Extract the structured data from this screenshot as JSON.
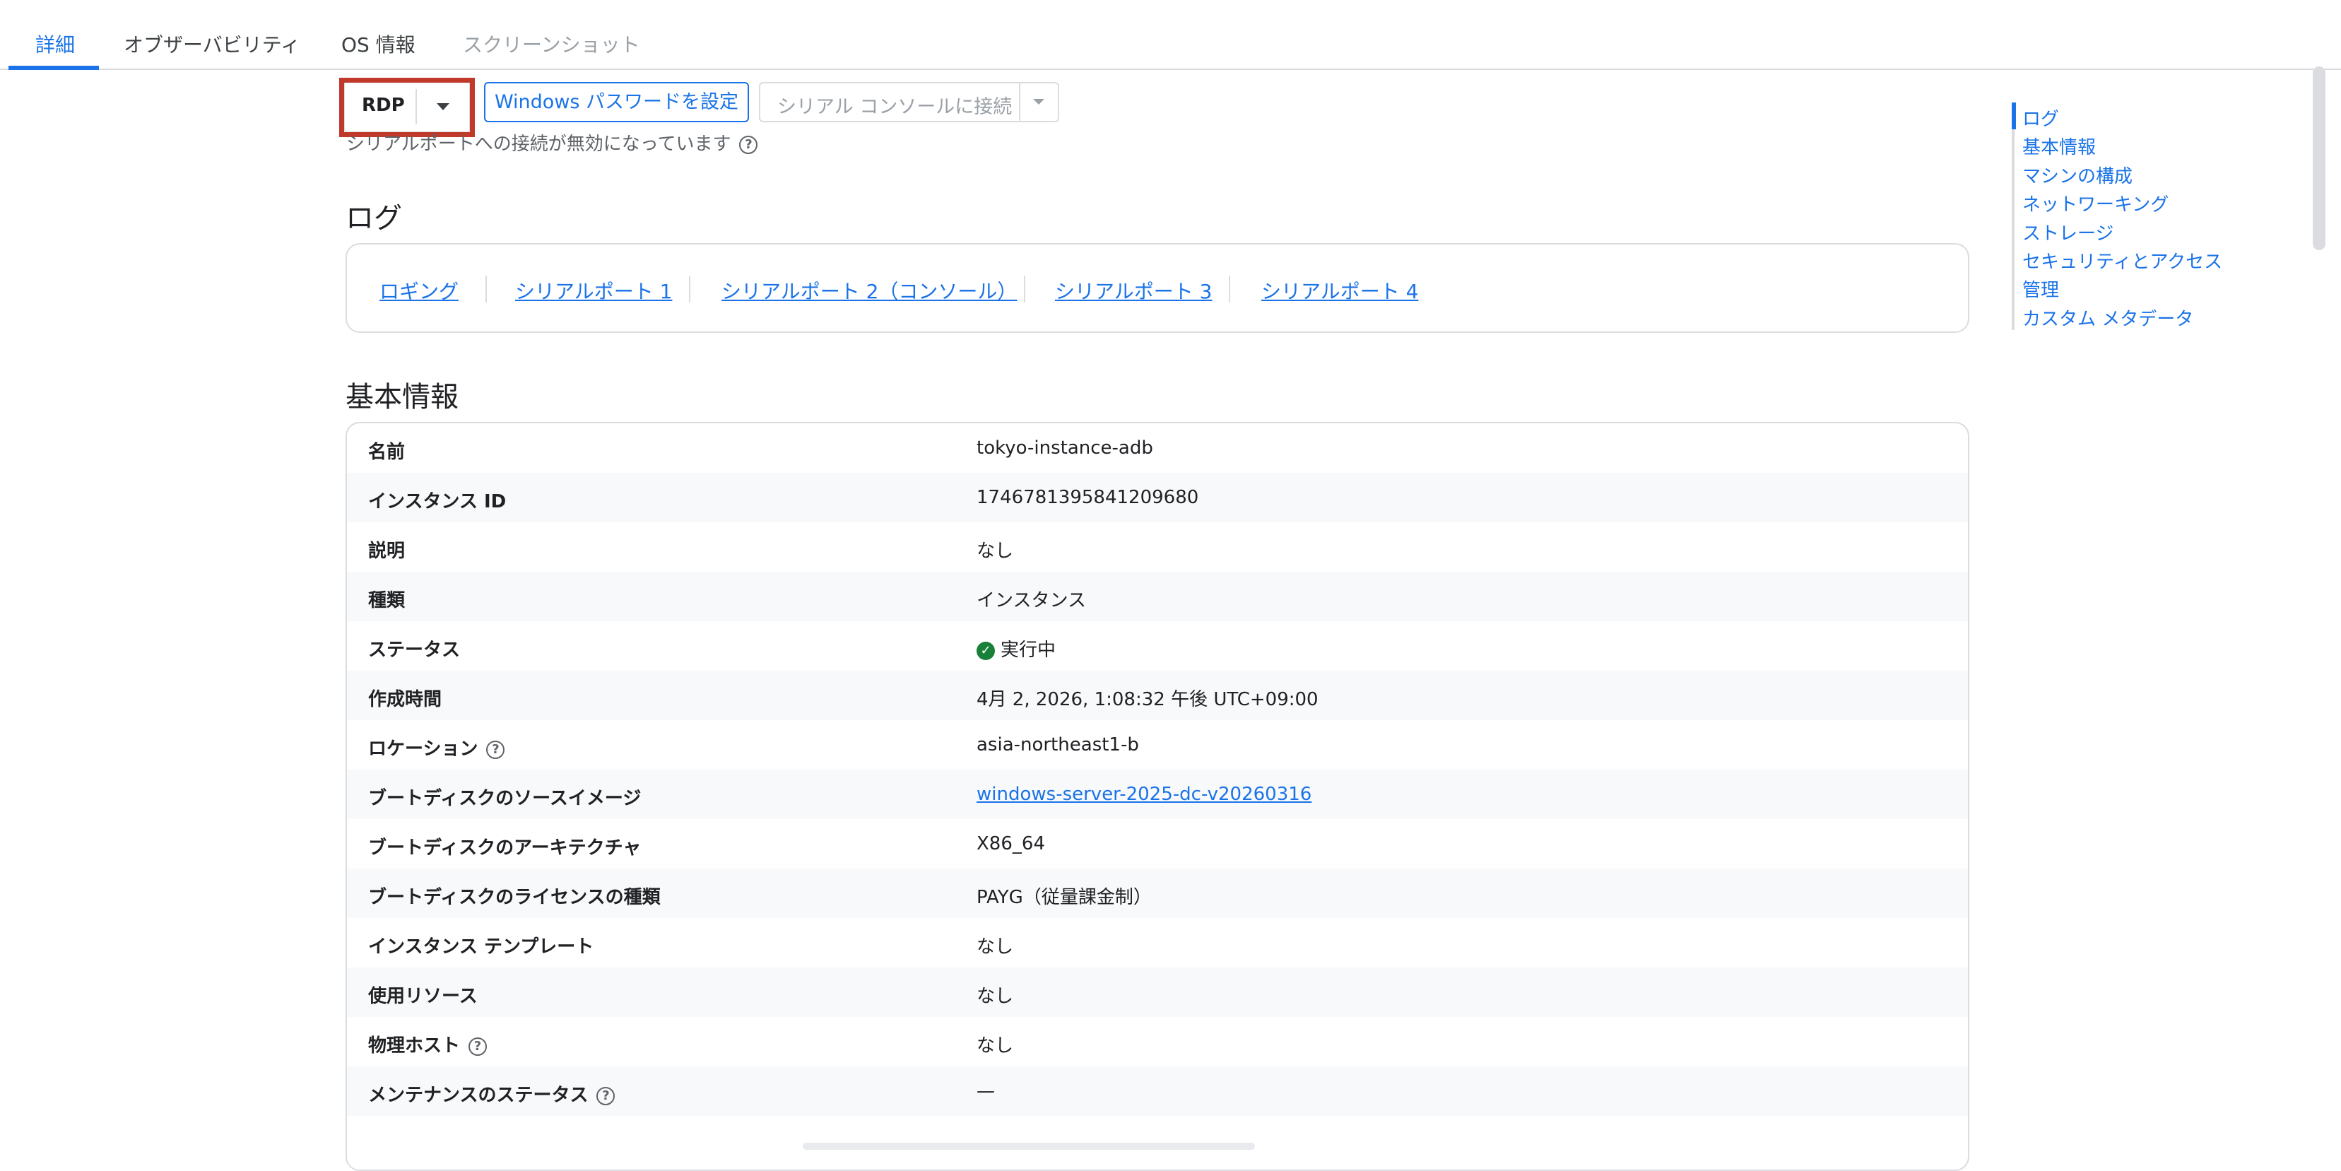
{
  "tabs": [
    {
      "label": "詳細",
      "state": "active"
    },
    {
      "label": "オブザーバビリティ",
      "state": "normal"
    },
    {
      "label": "OS 情報",
      "state": "normal"
    },
    {
      "label": "スクリーンショット",
      "state": "disabled"
    }
  ],
  "toolbar": {
    "rdp_label": "RDP",
    "windows_password_label": "Windows パスワードを設定",
    "serial_console_label": "シリアル コンソールに接続",
    "serial_note": "シリアルポートへの接続が無効になっています"
  },
  "log_section": {
    "title": "ログ",
    "links": [
      "ロギング",
      "シリアルポート 1",
      "シリアルポート 2（コンソール）",
      "シリアルポート 3",
      "シリアルポート 4"
    ]
  },
  "basic_info": {
    "title": "基本情報",
    "rows": [
      {
        "label": "名前",
        "value": "tokyo-instance-adb"
      },
      {
        "label": "インスタンス ID",
        "value": "1746781395841209680"
      },
      {
        "label": "説明",
        "value": "なし"
      },
      {
        "label": "種類",
        "value": "インスタンス"
      },
      {
        "label": "ステータス",
        "value": "実行中"
      },
      {
        "label": "作成時間",
        "value": "4月 2, 2026, 1:08:32 午後 UTC+09:00"
      },
      {
        "label": "ロケーション",
        "value": "asia-northeast1-b"
      },
      {
        "label": "ブートディスクのソースイメージ",
        "value": "windows-server-2025-dc-v20260316"
      },
      {
        "label": "ブートディスクのアーキテクチャ",
        "value": "X86_64"
      },
      {
        "label": "ブートディスクのライセンスの種類",
        "value": "PAYG（従量課金制）"
      },
      {
        "label": "インスタンス テンプレート",
        "value": "なし"
      },
      {
        "label": "使用リソース",
        "value": "なし"
      },
      {
        "label": "物理ホスト",
        "value": "なし"
      },
      {
        "label": "メンテナンスのステータス",
        "value": "—"
      }
    ]
  },
  "toc": {
    "items": [
      "ログ",
      "基本情報",
      "マシンの構成",
      "ネットワーキング",
      "ストレージ",
      "セキュリティとアクセス",
      "管理",
      "カスタム メタデータ"
    ]
  },
  "colors": {
    "accent": "#1a73e8",
    "highlight": "#c0392b",
    "status_ok": "#188038"
  },
  "icons": {
    "help": "help-circle-icon",
    "status": "check-circle-icon",
    "dropdown": "caret-down-icon"
  }
}
